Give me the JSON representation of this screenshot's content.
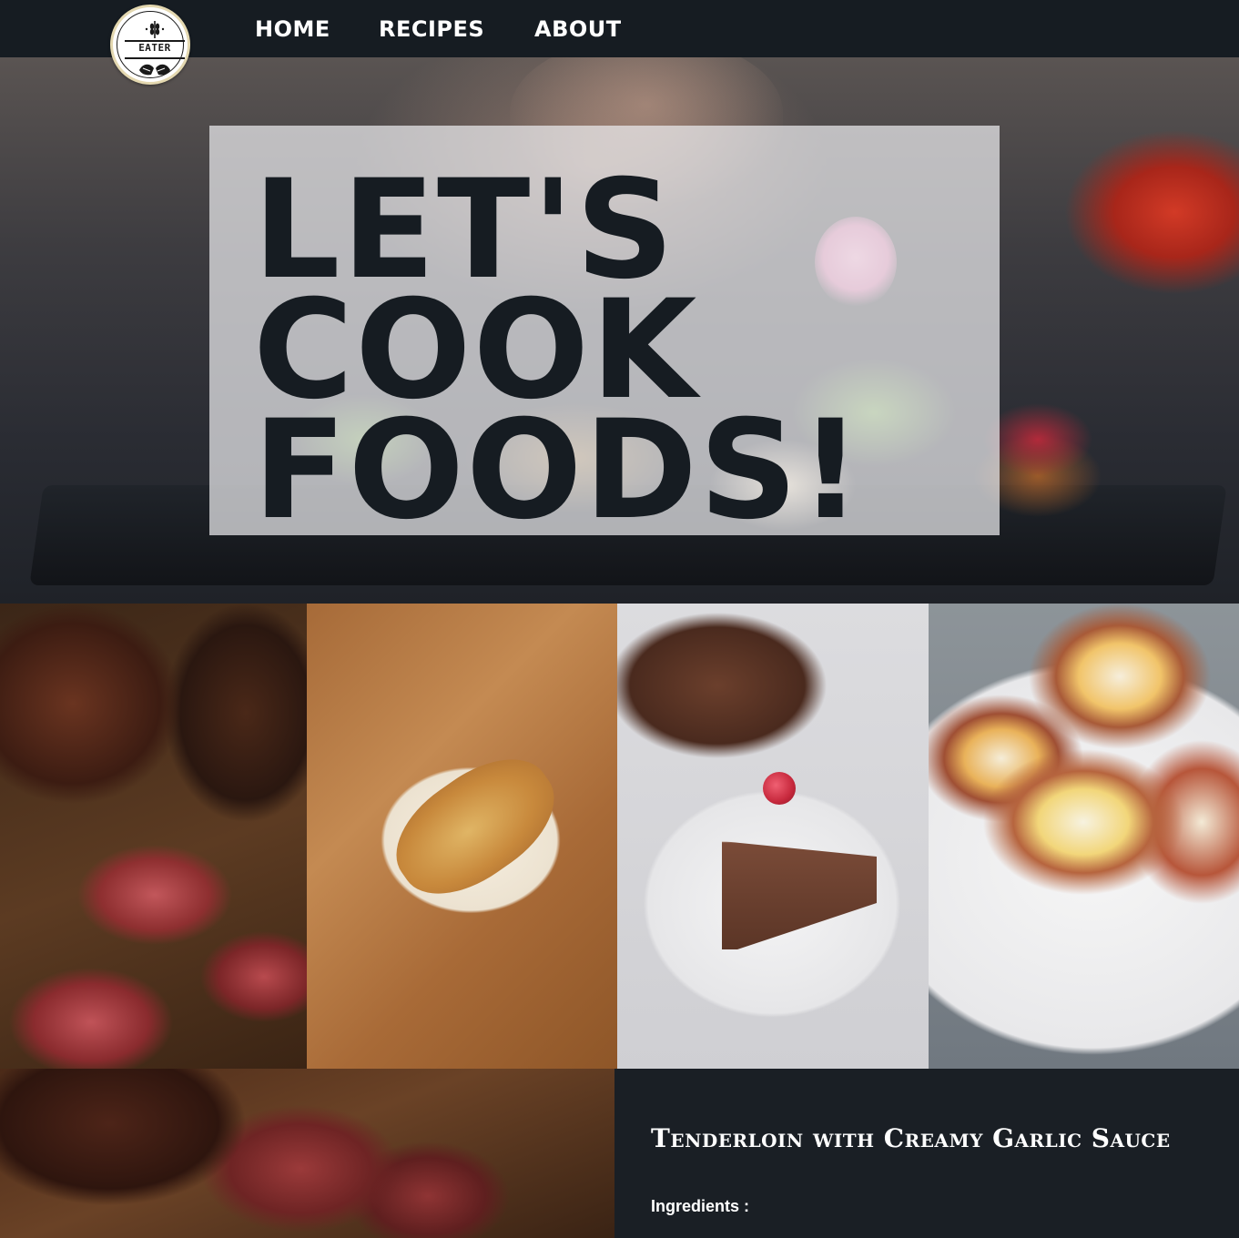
{
  "brand": {
    "logo_text": "EATER"
  },
  "nav": {
    "items": [
      {
        "label": "HOME"
      },
      {
        "label": "RECIPES"
      },
      {
        "label": "ABOUT"
      }
    ]
  },
  "hero": {
    "headline_lines": [
      "LET'S",
      "COOK",
      "FOODS!"
    ]
  },
  "gallery": {
    "photos": [
      {
        "subject": "sliced-beef-tenderloin"
      },
      {
        "subject": "stuffed-chicken-breast"
      },
      {
        "subject": "chocolate-cheesecake-slice"
      },
      {
        "subject": "prosciutto-egg-cups"
      },
      {
        "subject": "roast-beef-tenderloin"
      }
    ]
  },
  "recipe": {
    "title": "Tenderloin with Creamy Garlic Sauce",
    "ingredients_label": "Ingredients :"
  },
  "colors": {
    "navbar_bg": "#161c22",
    "page_bg": "#1a1f25",
    "hero_text": "#161c22",
    "hero_overlay": "rgba(235,235,238,0.72)",
    "text_light": "#ffffff"
  }
}
